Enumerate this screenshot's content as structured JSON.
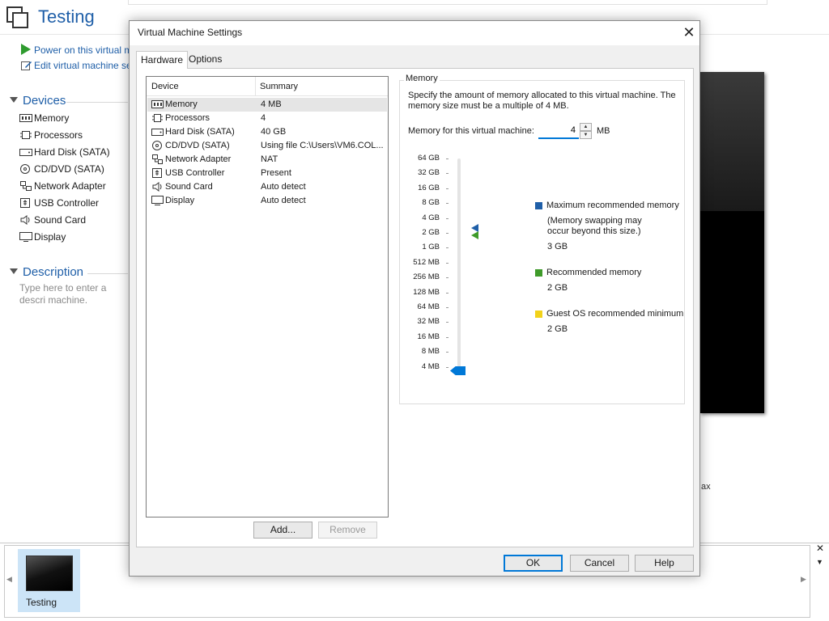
{
  "main_window": {
    "title": "Testing",
    "actions": [
      "Power on this virtual m",
      "Edit virtual machine se"
    ],
    "devices_heading": "Devices",
    "devices": [
      "Memory",
      "Processors",
      "Hard Disk (SATA)",
      "CD/DVD (SATA)",
      "Network Adapter",
      "USB Controller",
      "Sound Card",
      "Display"
    ],
    "description_heading": "Description",
    "description_placeholder": "Type here to enter a descri machine.",
    "side_fragment": "ax",
    "thumbnail_label": "Testing"
  },
  "dialog": {
    "title": "Virtual Machine Settings",
    "close_glyph": "✕",
    "tabs": [
      "Hardware",
      "Options"
    ],
    "active_tab": "Hardware",
    "device_list": {
      "columns": [
        "Device",
        "Summary"
      ],
      "rows": [
        {
          "name": "Memory",
          "summary": "4 MB",
          "icon": "memory-icon",
          "selected": true
        },
        {
          "name": "Processors",
          "summary": "4",
          "icon": "processor-icon"
        },
        {
          "name": "Hard Disk (SATA)",
          "summary": "40 GB",
          "icon": "hard-disk-icon"
        },
        {
          "name": "CD/DVD (SATA)",
          "summary": "Using file C:\\Users\\VM6.COL...",
          "icon": "cd-dvd-icon"
        },
        {
          "name": "Network Adapter",
          "summary": "NAT",
          "icon": "network-adapter-icon"
        },
        {
          "name": "USB Controller",
          "summary": "Present",
          "icon": "usb-controller-icon"
        },
        {
          "name": "Sound Card",
          "summary": "Auto detect",
          "icon": "sound-card-icon"
        },
        {
          "name": "Display",
          "summary": "Auto detect",
          "icon": "display-icon"
        }
      ]
    },
    "add_button": "Add...",
    "remove_button": "Remove",
    "memory": {
      "group_title": "Memory",
      "description": "Specify the amount of memory allocated to this virtual machine. The memory size must be a multiple of 4 MB.",
      "field_label": "Memory for this virtual machine:",
      "value": "4",
      "unit": "MB",
      "scale_labels": [
        "64 GB",
        "32 GB",
        "16 GB",
        "8 GB",
        "4 GB",
        "2 GB",
        "1 GB",
        "512 MB",
        "256 MB",
        "128 MB",
        "64 MB",
        "32 MB",
        "16 MB",
        "8 MB",
        "4 MB"
      ],
      "slider_value": "4 MB",
      "legend": [
        {
          "label": "Maximum recommended memory",
          "note": "(Memory swapping may occur beyond this size.)",
          "value": "3 GB",
          "color": "#1f5fa8"
        },
        {
          "label": "Recommended memory",
          "note": "",
          "value": "2 GB",
          "color": "#3f9b2a"
        },
        {
          "label": "Guest OS recommended minimum",
          "note": "",
          "value": "2 GB",
          "color": "#f2d21a"
        }
      ]
    },
    "buttons": {
      "ok": "OK",
      "cancel": "Cancel",
      "help": "Help"
    }
  }
}
